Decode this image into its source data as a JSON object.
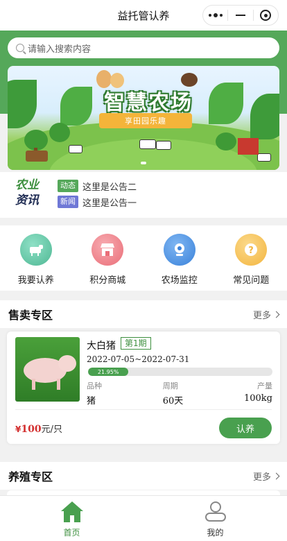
{
  "topbar": {
    "title": "益托管认养",
    "menu_icon": "more-dots-icon",
    "minimize_icon": "minimize-icon",
    "close_icon": "target-close-icon"
  },
  "colors": {
    "brand_green": "#55a85a",
    "button_green": "#49a04f",
    "price_red": "#d32f2f",
    "news_tag_dynamic": "#55a85a",
    "news_tag_news": "#6f78d6"
  },
  "search": {
    "placeholder": "请输入搜索内容"
  },
  "banner": {
    "headline": "智慧农场",
    "ribbon": "享田园乐趣"
  },
  "news": {
    "logo_line1": "农业",
    "logo_line2": "资讯",
    "items": [
      {
        "tag": "动态",
        "text": "这里是公告二"
      },
      {
        "tag": "新闻",
        "text": "这里是公告一"
      }
    ]
  },
  "menu": {
    "items": [
      {
        "label": "我要认养",
        "icon": "cow-icon",
        "color": "#5fc3a4"
      },
      {
        "label": "积分商城",
        "icon": "shop-icon",
        "color": "#f0808a"
      },
      {
        "label": "农场监控",
        "icon": "camera-icon",
        "color": "#4a90e2"
      },
      {
        "label": "常见问题",
        "icon": "question-icon",
        "color": "#f5c04a"
      }
    ]
  },
  "sale_section": {
    "title": "售卖专区",
    "more": "更多",
    "product": {
      "name": "大白猪",
      "period": "第1期",
      "date_range": "2022-07-05~2022-07-31",
      "progress_label": "21.95%",
      "progress": 0.2195,
      "specs": [
        {
          "key": "品种",
          "value": "猪"
        },
        {
          "key": "周期",
          "value": "60天"
        },
        {
          "key": "产量",
          "value": "100kg"
        }
      ],
      "price_currency": "¥",
      "price_value": "100",
      "price_unit": "元/只",
      "adopt_label": "认养"
    }
  },
  "breed_section": {
    "title": "养殖专区",
    "more": "更多"
  },
  "tabbar": {
    "tabs": [
      {
        "label": "首页",
        "icon": "home-icon",
        "active": true
      },
      {
        "label": "我的",
        "icon": "profile-icon",
        "active": false
      }
    ]
  }
}
